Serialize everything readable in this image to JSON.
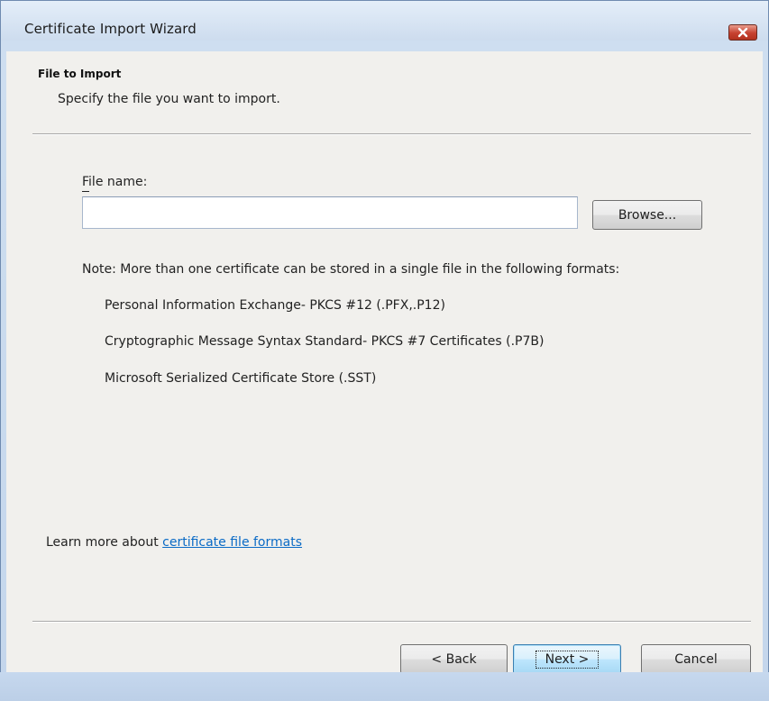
{
  "window": {
    "title": "Certificate Import Wizard",
    "close_icon": "close-x-icon"
  },
  "header": {
    "heading": "File to Import",
    "subheading": "Specify the file you want to import."
  },
  "file": {
    "label": "File name:",
    "value": "",
    "browse_label": "Browse..."
  },
  "note": {
    "text": "Note:  More than one certificate can be stored in a single file in the following formats:",
    "formats": [
      "Personal Information Exchange- PKCS #12 (.PFX,.P12)",
      "Cryptographic Message Syntax Standard- PKCS #7 Certificates (.P7B)",
      "Microsoft Serialized Certificate Store (.SST)"
    ]
  },
  "learn_more": {
    "prefix": "Learn more about ",
    "link": "certificate file formats"
  },
  "buttons": {
    "back": "< Back",
    "next": "Next >",
    "cancel": "Cancel"
  },
  "colors": {
    "link": "#0b6bc6",
    "close_button": "#c6412f",
    "default_button_border": "#3c7fb1"
  }
}
